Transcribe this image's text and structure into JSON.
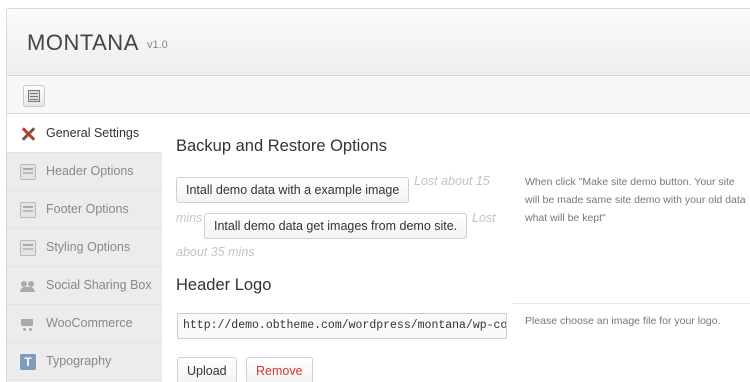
{
  "app": {
    "title": "MONTANA",
    "version": "v1.0"
  },
  "toolbar": {
    "icon": "list-icon"
  },
  "sidebar": {
    "items": [
      {
        "label": "General Settings",
        "icon": "tools-icon",
        "active": true
      },
      {
        "label": "Header Options",
        "icon": "header-icon"
      },
      {
        "label": "Footer Options",
        "icon": "footer-icon"
      },
      {
        "label": "Styling Options",
        "icon": "styling-icon"
      },
      {
        "label": "Social Sharing Box",
        "icon": "people-icon"
      },
      {
        "label": "WooCommerce",
        "icon": "cart-icon"
      },
      {
        "label": "Typography",
        "icon": "typography-icon",
        "glyph": "T"
      }
    ]
  },
  "main": {
    "backup": {
      "title": "Backup and Restore Options",
      "button_example": "Intall demo data with a example image",
      "button_demo": "Intall demo data get images from demo site.",
      "ghost_1a": "Lost about 15",
      "ghost_1b": "mins",
      "ghost_2a": "Lost",
      "ghost_2b": "about 35 mins",
      "description": "When click \"Make site demo button. Your site will be made same site demo with your old data what will be kept\""
    },
    "logo": {
      "title": "Header Logo",
      "url_value": "http://demo.obtheme.com/wordpress/montana/wp-cont",
      "description": "Please choose an image file for your logo.",
      "upload_label": "Upload",
      "remove_label": "Remove"
    }
  },
  "colors": {
    "remove": "#d9342b",
    "typography_icon": "#7f9bbf"
  }
}
